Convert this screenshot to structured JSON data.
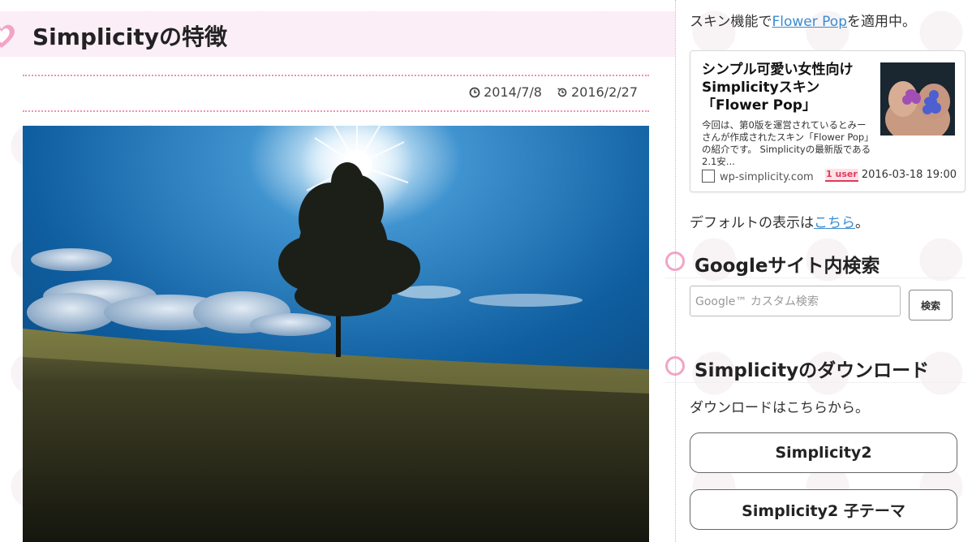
{
  "article": {
    "title": "Simplicityの特徴",
    "published": "2014/7/8",
    "updated": "2016/2/27",
    "hero_image_alt": "tree-on-hill-photo"
  },
  "sidebar": {
    "skin_prefix": "スキン機能で",
    "skin_link": "Flower Pop",
    "skin_suffix": "を適用中。",
    "card": {
      "title": "シンプル可愛い女性向けSimplicityスキン「Flower Pop」",
      "excerpt": "今回は、第0版を運営されているとみーさんが作成されたスキン「Flower Pop」の紹介です。 Simplicityの最新版である2.1安...",
      "site": "wp-simplicity.com",
      "users": "1 user",
      "date": "2016-03-18 19:00"
    },
    "default_prefix": "デフォルトの表示は",
    "default_link": "こちら",
    "default_suffix": "。",
    "search_widget": {
      "title": "Googleサイト内検索",
      "placeholder": "Google™ カスタム検索",
      "button": "検索"
    },
    "download_widget": {
      "title": "Simplicityのダウンロード",
      "text": "ダウンロードはこちらから。",
      "buttons": [
        "Simplicity2",
        "Simplicity2 子テーマ"
      ]
    }
  },
  "colors": {
    "accent_pink": "#f28fb8",
    "title_bg": "#fbeef6",
    "link_blue": "#3a8bd2"
  }
}
